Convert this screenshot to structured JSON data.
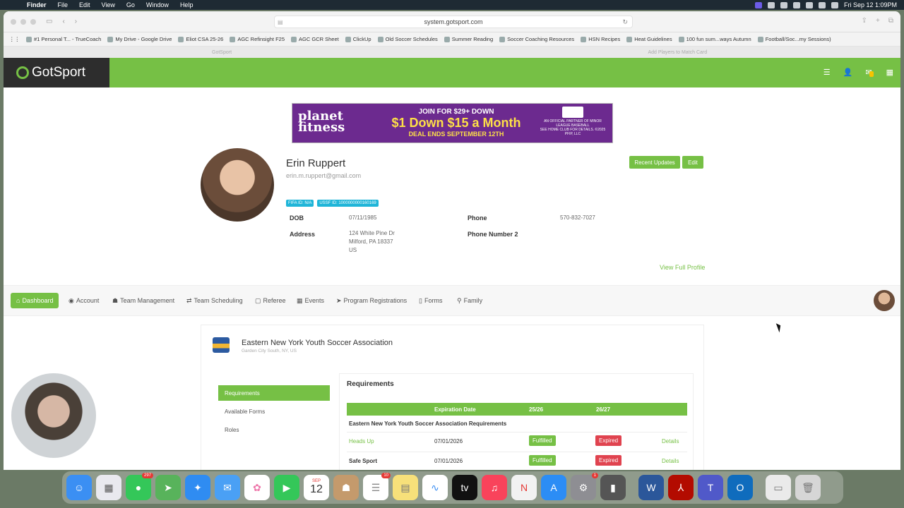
{
  "menubar": {
    "app": "Finder",
    "items": [
      "File",
      "Edit",
      "View",
      "Go",
      "Window",
      "Help"
    ],
    "clock": "Fri Sep 12  1:09PM"
  },
  "browser": {
    "url": "system.gotsport.com",
    "bookmarks": [
      "#1 Personal T... - TrueCoach",
      "My Drive - Google Drive",
      "Eliot CSA 25-26",
      "AGC Refinsight F25",
      "AGC GCR Sheet",
      "ClickUp",
      "Old Soccer Schedules",
      "Summer Reading",
      "Soccer Coaching Resources",
      "HSN Recipes",
      "Heat Guidelines",
      "100 fun sum...ways Autumn",
      "Football/Soc...my Sessions)"
    ],
    "tabs": [
      "GotSport",
      "Add Players to Match Card"
    ]
  },
  "header": {
    "logo": "GotSport",
    "notification_badge": ""
  },
  "ad": {
    "brand_line1": "planet",
    "brand_line2": "fitness",
    "join_for": "JOIN FOR $29+ DOWN",
    "offer": "$1 Down $15 a Month",
    "deal": "DEAL ENDS SEPTEMBER 12TH",
    "partner": "AN OFFICIAL PARTNER OF MINOR LEAGUE BASEBALL",
    "fine_print": "SEE HOME CLUB FOR DETAILS. ©2025 PFIP, LLC"
  },
  "profile": {
    "name": "Erin Ruppert",
    "email": "erin.m.ruppert@gmail.com",
    "recent_updates": "Recent Updates",
    "edit": "Edit",
    "fifa_id": "FIFA ID: N/A",
    "ussf_id": "USSF ID: 1000000000160169",
    "dob_label": "DOB",
    "dob": "07/11/1985",
    "address_label": "Address",
    "address_line1": "124 White Pine Dr",
    "address_line2": "Milford, PA 18337",
    "address_line3": "US",
    "phone_label": "Phone",
    "phone": "570-832-7027",
    "phone2_label": "Phone Number 2",
    "view_full": "View Full Profile"
  },
  "nav": [
    "Dashboard",
    "Account",
    "Team Management",
    "Team Scheduling",
    "Referee",
    "Events",
    "Program Registrations",
    "Forms",
    "Family"
  ],
  "org": {
    "name": "Eastern New York Youth Soccer Association",
    "location": "Garden City South, NY, US",
    "side": [
      "Requirements",
      "Available Forms",
      "Roles"
    ],
    "req_title": "Requirements",
    "columns": [
      "Expiration Date",
      "25/26",
      "26/27"
    ],
    "group": "Eastern New York Youth Soccer Association Requirements",
    "rows": [
      {
        "name": "Heads Up",
        "date": "07/01/2026",
        "c1": "Fulfilled",
        "c2": "Expired",
        "link": "Details"
      },
      {
        "name": "Safe Sport",
        "date": "07/01/2026",
        "c1": "Fulfilled",
        "c2": "Expired",
        "link": "Details"
      }
    ]
  },
  "dock": {
    "apps": [
      "Finder",
      "Launchpad",
      "Messages",
      "Maps",
      "Safari",
      "Mail",
      "Photos",
      "FaceTime",
      "Calendar",
      "Contacts",
      "Reminders",
      "Notes",
      "Freeform",
      "TV",
      "Music",
      "News",
      "App Store",
      "System Settings",
      "Remote",
      "Word",
      "Acrobat",
      "Teams",
      "Outlook",
      "Preview",
      "Trash"
    ],
    "messages_badge": "297",
    "reminders_badge": "10",
    "settings_badge": "1",
    "calendar_month": "SEP",
    "calendar_day": "12"
  }
}
